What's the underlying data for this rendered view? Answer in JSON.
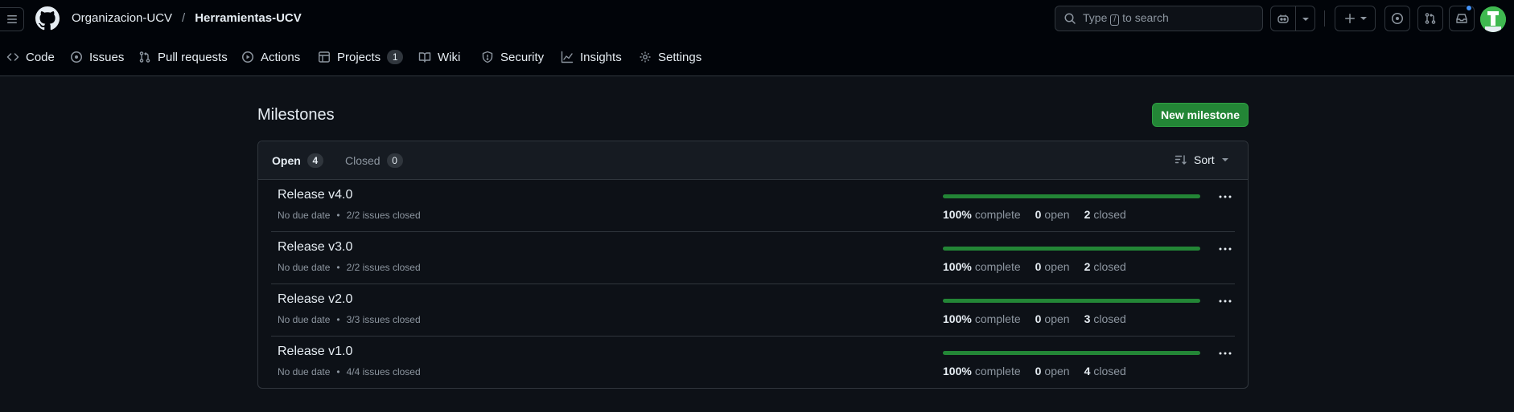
{
  "header": {
    "owner": "Organizacion-UCV",
    "separator": "/",
    "repo": "Herramientas-UCV",
    "search": {
      "prefix": "Type",
      "key": "/",
      "suffix": "to search"
    }
  },
  "nav": {
    "items": [
      {
        "label": "Code",
        "icon": "code-icon"
      },
      {
        "label": "Issues",
        "icon": "issue-opened-icon"
      },
      {
        "label": "Pull requests",
        "icon": "git-pull-request-icon"
      },
      {
        "label": "Actions",
        "icon": "play-icon"
      },
      {
        "label": "Projects",
        "icon": "table-icon",
        "count": "1"
      },
      {
        "label": "Wiki",
        "icon": "book-icon"
      },
      {
        "label": "Security",
        "icon": "shield-icon"
      },
      {
        "label": "Insights",
        "icon": "graph-icon"
      },
      {
        "label": "Settings",
        "icon": "gear-icon"
      }
    ]
  },
  "main": {
    "title": "Milestones",
    "new_button": "New milestone",
    "tabs": {
      "open_label": "Open",
      "open_count": "4",
      "closed_label": "Closed",
      "closed_count": "0"
    },
    "sort_label": "Sort",
    "milestones": [
      {
        "title": "Release v4.0",
        "due": "No due date",
        "issues": "2/2 issues closed",
        "percent": "100%",
        "complete_label": "complete",
        "open": "0",
        "open_label": "open",
        "closed": "2",
        "closed_label": "closed",
        "progress": 1.0
      },
      {
        "title": "Release v3.0",
        "due": "No due date",
        "issues": "2/2 issues closed",
        "percent": "100%",
        "complete_label": "complete",
        "open": "0",
        "open_label": "open",
        "closed": "2",
        "closed_label": "closed",
        "progress": 1.0
      },
      {
        "title": "Release v2.0",
        "due": "No due date",
        "issues": "3/3 issues closed",
        "percent": "100%",
        "complete_label": "complete",
        "open": "0",
        "open_label": "open",
        "closed": "3",
        "closed_label": "closed",
        "progress": 1.0
      },
      {
        "title": "Release v1.0",
        "due": "No due date",
        "issues": "4/4 issues closed",
        "percent": "100%",
        "complete_label": "complete",
        "open": "0",
        "open_label": "open",
        "closed": "4",
        "closed_label": "closed",
        "progress": 1.0
      }
    ]
  },
  "colors": {
    "background": "#0d1117",
    "header_background": "#010409",
    "primary_button": "#238636",
    "progress_fill": "#238636",
    "notification_dot": "#4493f8"
  }
}
